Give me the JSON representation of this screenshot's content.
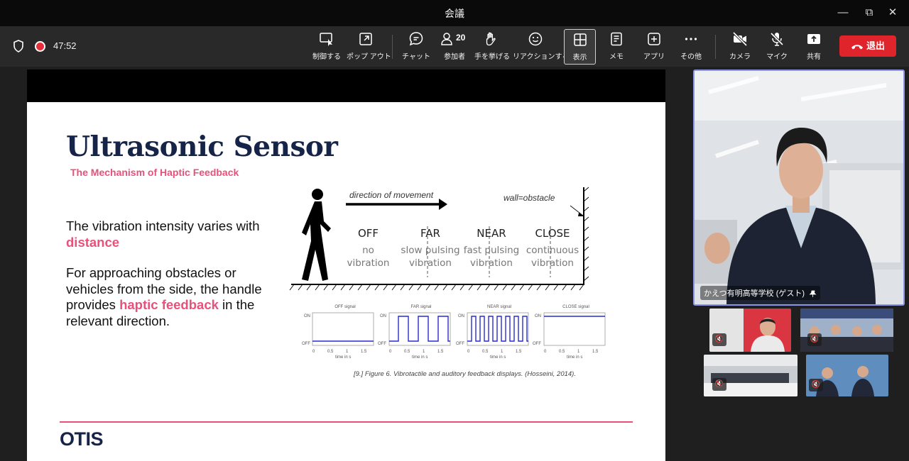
{
  "window": {
    "title": "会議"
  },
  "call": {
    "elapsed": "47:52"
  },
  "toolbar": {
    "buttons": [
      {
        "label": "制御する",
        "icon": "control-icon"
      },
      {
        "label": "ポップ アウト",
        "icon": "pop-out-icon"
      },
      {
        "label": "チャット",
        "icon": "chat-icon"
      },
      {
        "label": "参加者",
        "icon": "participants-icon",
        "count": "20"
      },
      {
        "label": "手を挙げる",
        "icon": "raise-hand-icon"
      },
      {
        "label": "リアクションする",
        "icon": "reaction-icon"
      },
      {
        "label": "表示",
        "icon": "view-icon",
        "active": true
      },
      {
        "label": "メモ",
        "icon": "notes-icon"
      },
      {
        "label": "アプリ",
        "icon": "apps-icon"
      },
      {
        "label": "その他",
        "icon": "more-icon"
      },
      {
        "label": "カメラ",
        "icon": "camera-off-icon"
      },
      {
        "label": "マイク",
        "icon": "mic-off-icon"
      },
      {
        "label": "共有",
        "icon": "share-icon"
      }
    ],
    "leave_label": "退出",
    "leave_color": "#e0242c"
  },
  "slide": {
    "title": "Ultrasonic Sensor",
    "subtitle": "The Mechanism of Haptic Feedback",
    "para1": {
      "before": "The vibration intensity varies with ",
      "em": "distance"
    },
    "para2": {
      "before": "For approaching obstacles or vehicles from the side, the handle provides ",
      "em": "haptic feedback",
      "after": " in the relevant direction."
    },
    "diagram": {
      "direction_label": "direction of movement",
      "wall_label": "wall=obstacle",
      "zones": [
        {
          "name": "OFF",
          "desc1": "no",
          "desc2": "vibration"
        },
        {
          "name": "FAR",
          "desc1": "slow pulsing",
          "desc2": "vibration"
        },
        {
          "name": "NEAR",
          "desc1": "fast pulsing",
          "desc2": "vibration"
        },
        {
          "name": "CLOSE",
          "desc1": "continuous",
          "desc2": "vibration"
        }
      ],
      "signals": [
        "OFF signal",
        "FAR signal",
        "NEAR signal",
        "CLOSE signal"
      ],
      "axis_on": "ON",
      "axis_off": "OFF",
      "ticks": [
        "0",
        "0.5",
        "1",
        "1.5"
      ],
      "time_label": "time in s"
    },
    "caption": "[9.] Figure 6. Vibrotactile and auditory feedback displays. (Hosseini, 2014).",
    "logo": "OTIS",
    "accent_color": "#e8517a",
    "title_color": "#152447"
  },
  "video": {
    "main_name": "かえつ有明高等学校 (ゲスト)"
  }
}
